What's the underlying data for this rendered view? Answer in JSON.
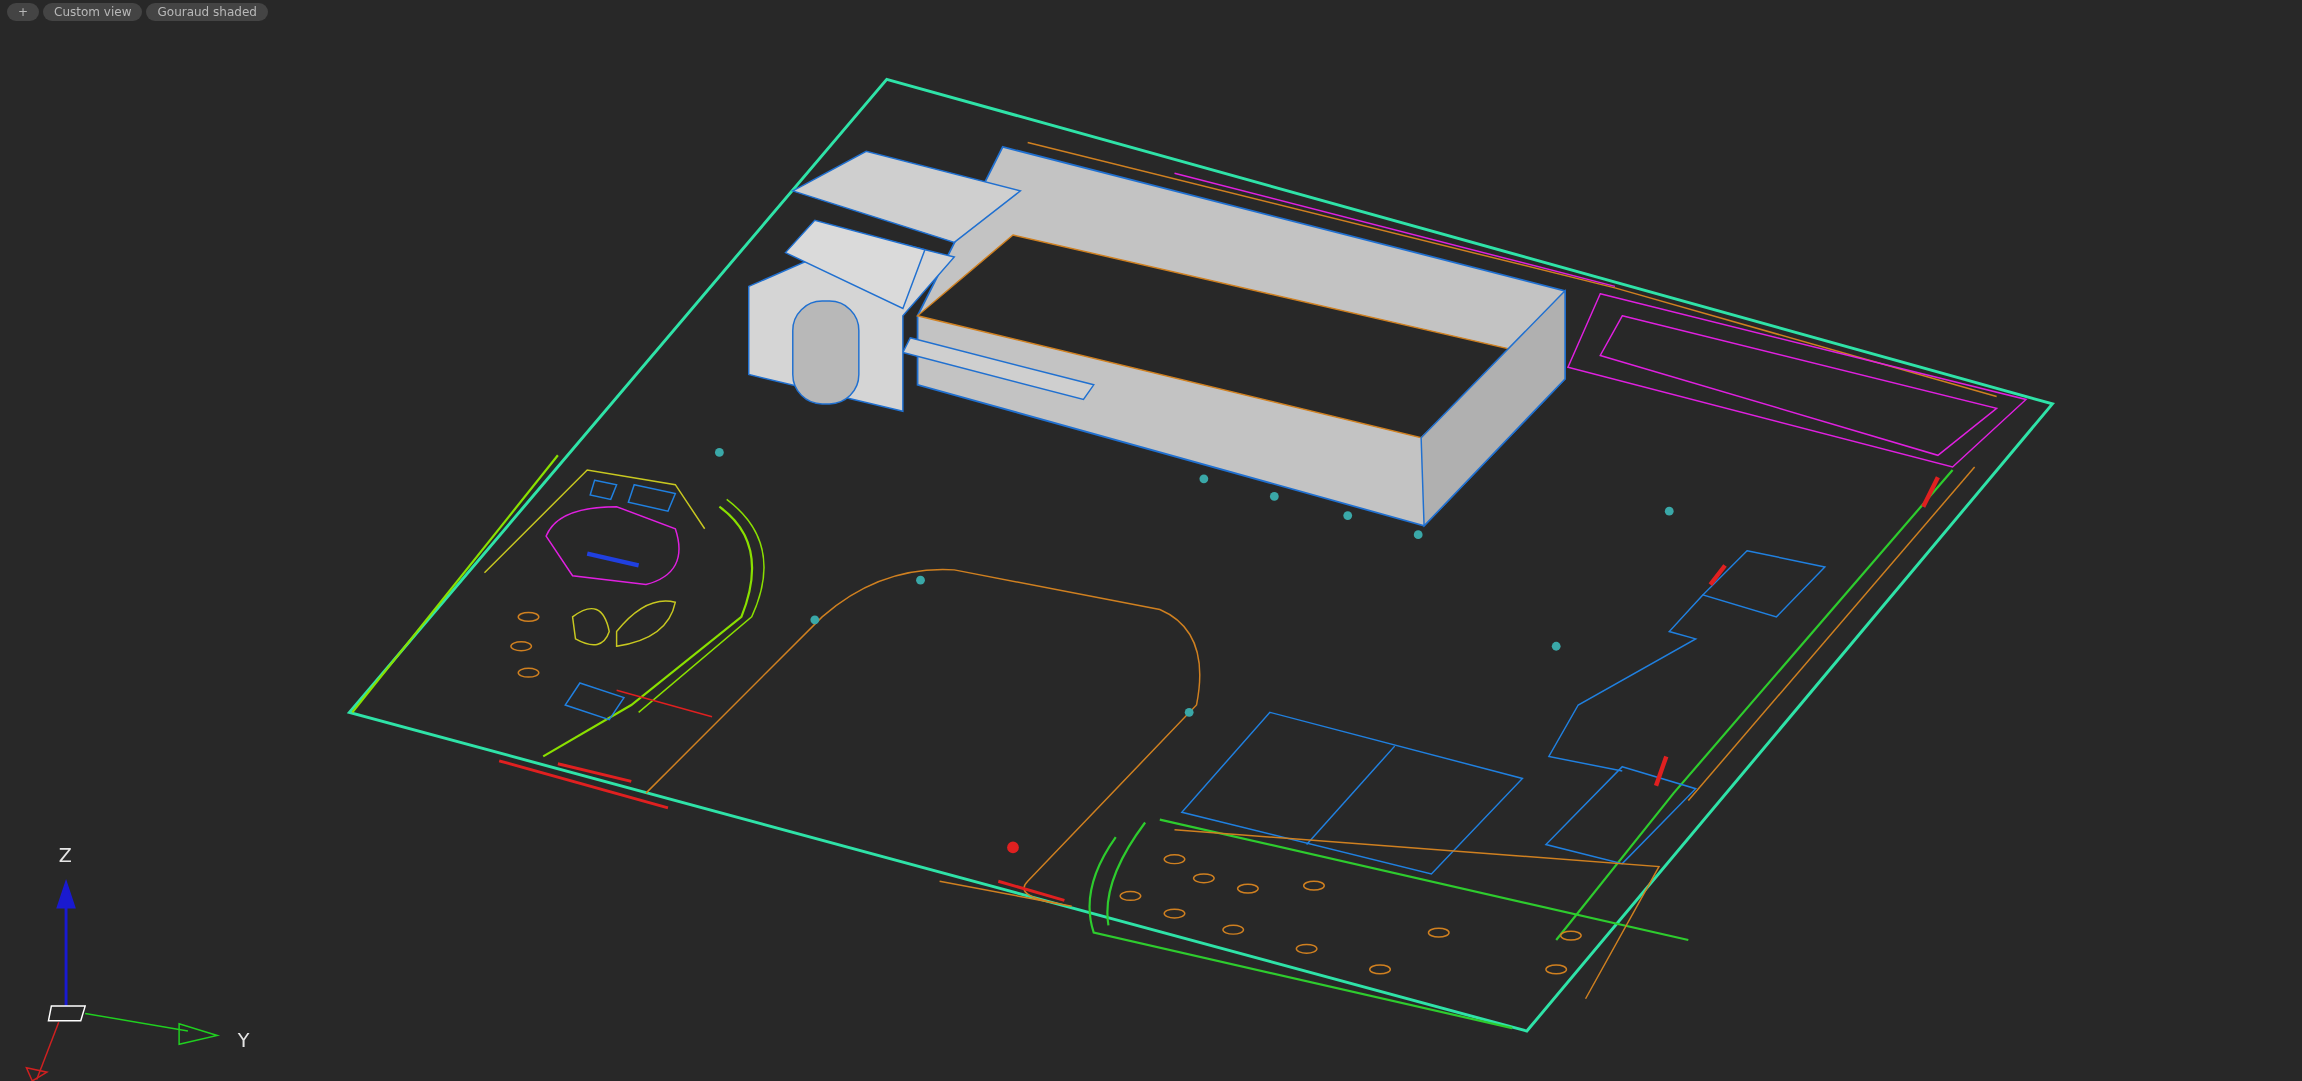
{
  "toolbar": [
    {
      "label": "+"
    },
    {
      "label": "Custom view"
    },
    {
      "label": "Gouraud shaded"
    }
  ],
  "axis_labels": [
    {
      "label": "Z"
    },
    {
      "label": "Y"
    }
  ]
}
